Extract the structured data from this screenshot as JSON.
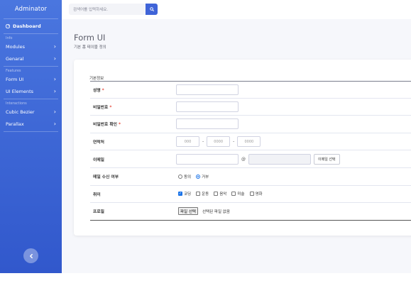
{
  "sidebar": {
    "brand": "Adminator",
    "dashboard": "Dashboard",
    "sections": {
      "info": "Info",
      "features": "Features",
      "interactions": "Interactions"
    },
    "items": {
      "modules": "Modules",
      "general": "Genaral",
      "form_ui": "Form UI",
      "ui_elements": "UI Elements",
      "cubic_bezier": "Cubic Bezier",
      "parallax": "Parallax"
    },
    "collapse_icon": "chevron-left-icon"
  },
  "topbar": {
    "search_placeholder": "검색어를 입력하세요.",
    "search_icon": "search-icon"
  },
  "page": {
    "title": "Form UI",
    "subtitle": "기본 폼 테이블 정의"
  },
  "form": {
    "legend": "기본정보",
    "required_mark": "*",
    "rows": {
      "name_label": "성명",
      "password_label": "비밀번호",
      "password_confirm_label": "비밀번호 확인",
      "phone_label": "연락처",
      "phone_placeholders": [
        "000",
        "0000",
        "0000"
      ],
      "phone_sep": "-",
      "email_label": "이메일",
      "email_at": "@",
      "email_select_button": "이메일 선택",
      "mail_receive_label": "메일 수신 여부",
      "mail_receive_options": [
        "동의",
        "거부"
      ],
      "mail_receive_selected": "거부",
      "hobby_label": "취미",
      "hobby_options": [
        "코딩",
        "운동",
        "음악",
        "미술",
        "영화"
      ],
      "hobby_checked": [
        "코딩"
      ],
      "profile_label": "프로필",
      "file_button": "파일 선택",
      "file_status": "선택된 파일 없음"
    }
  },
  "colors": {
    "sidebar_top": "#4a76df",
    "sidebar_bottom": "#3158cc",
    "accent": "#3f64d8",
    "required": "#e74a3b"
  }
}
